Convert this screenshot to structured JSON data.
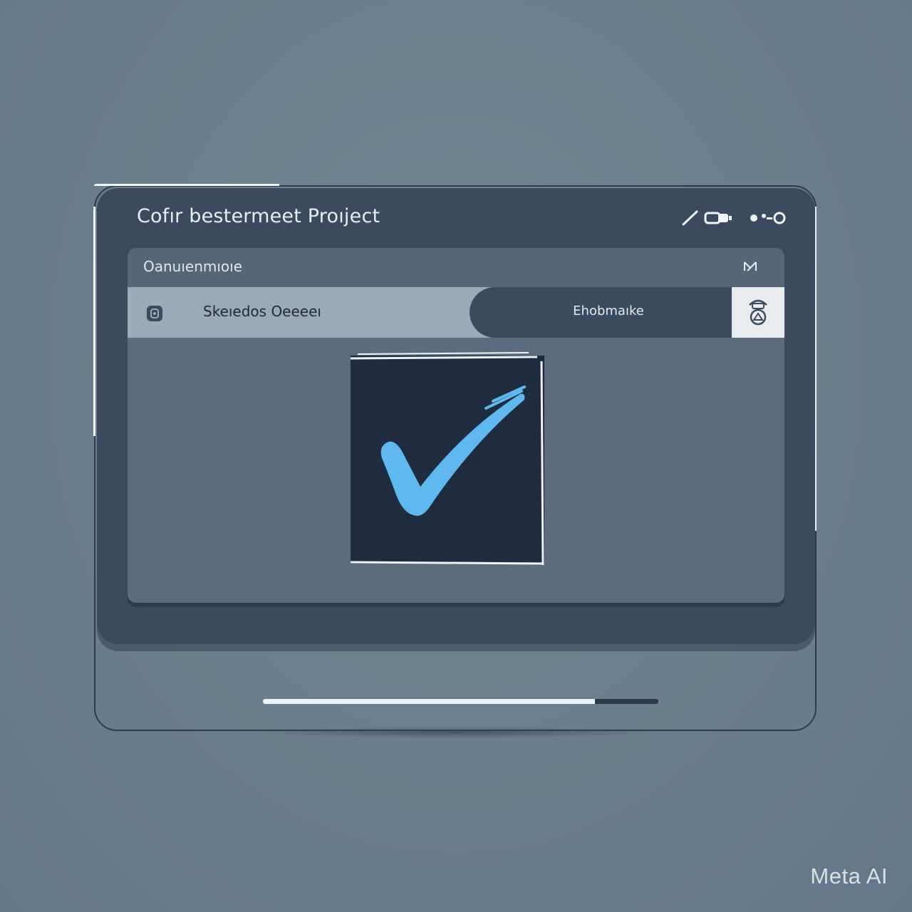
{
  "window": {
    "title": "Cofır bestermeet Proıject"
  },
  "subheader": {
    "label": "Oanuıenmıoıe"
  },
  "row": {
    "left_label": "Skeıedos Oeeeeı",
    "pill_label": "Ehobmaıke"
  },
  "progress": {
    "fraction": 0.84
  },
  "icons": {
    "title_controls": [
      "pen-icon",
      "toggle-icon",
      "more-icon"
    ],
    "subheader_close": "close-icon",
    "row_left": "lock-icon",
    "row_end": "reload-icon",
    "center": "checkmark-icon"
  },
  "colors": {
    "window": "#3b4a5e",
    "content": "#5b6c7e",
    "row_left": "#9aaab8",
    "checkmark": "#5fb8ee",
    "check_box": "#1f2b3f"
  },
  "watermark": "Meta AI"
}
